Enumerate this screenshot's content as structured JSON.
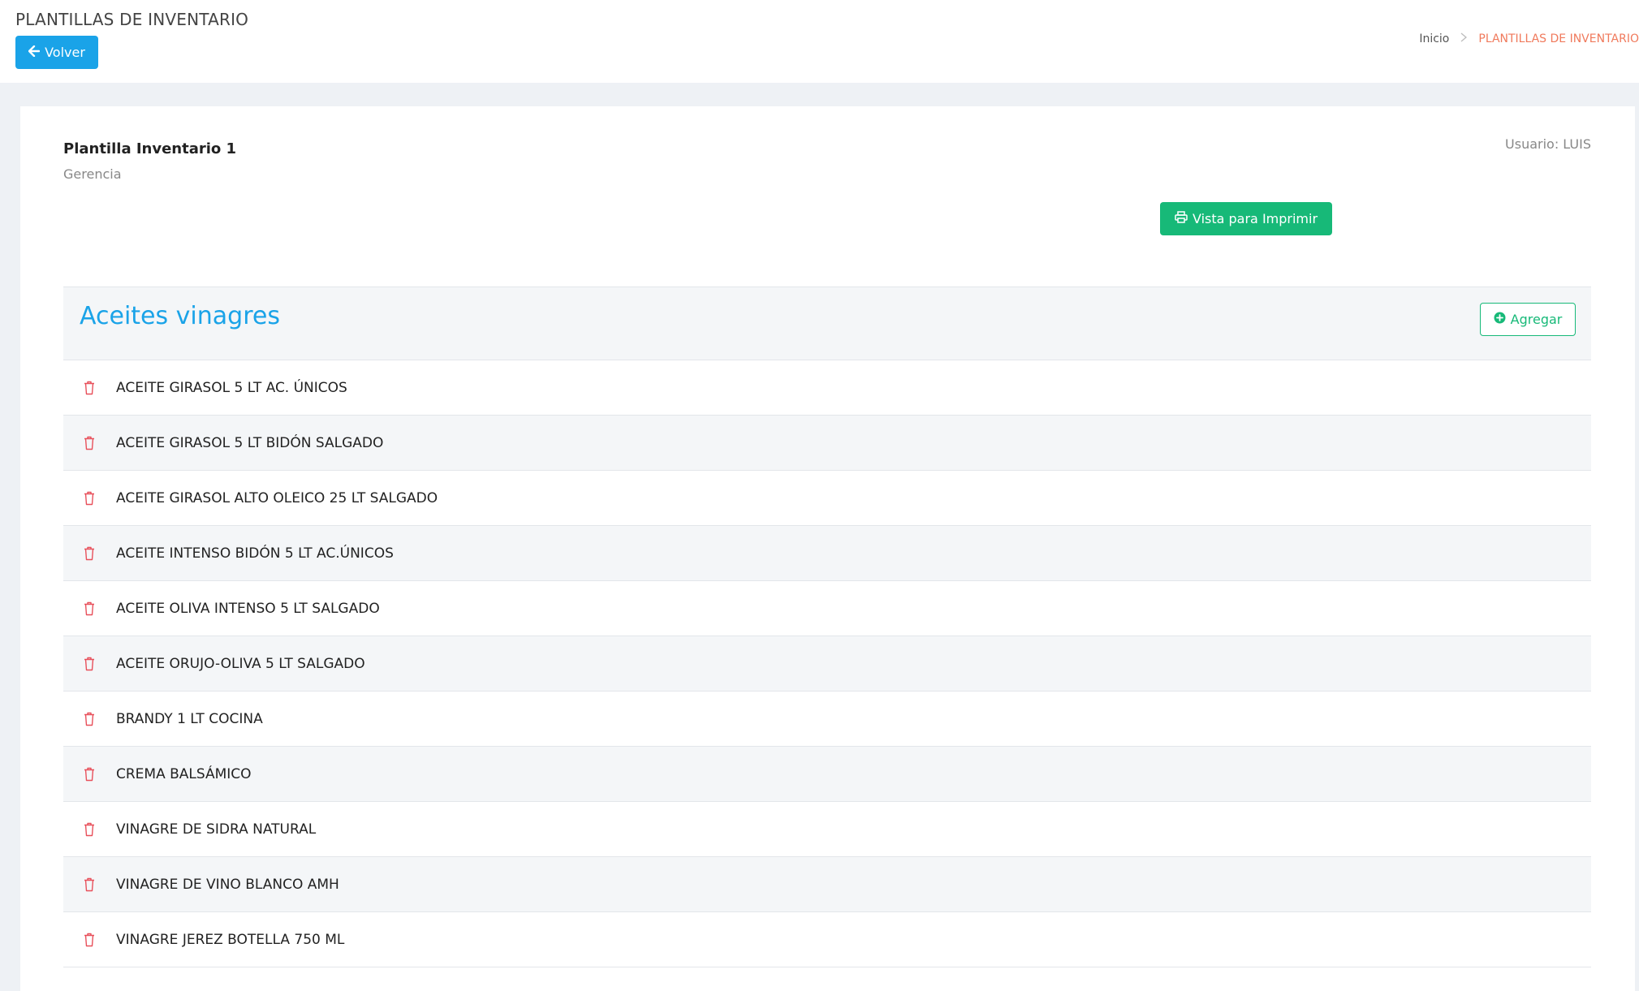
{
  "header": {
    "title": "PLANTILLAS DE INVENTARIO",
    "back_label": "Volver",
    "breadcrumb": {
      "home": "Inicio",
      "current": "PLANTILLAS DE INVENTARIO"
    }
  },
  "template": {
    "name": "Plantilla Inventario 1",
    "department": "Gerencia",
    "user": "Usuario: LUIS",
    "print_label": "Vista para Imprimir"
  },
  "section": {
    "title": "Aceites vinagres",
    "add_label": "Agregar",
    "items": [
      "ACEITE GIRASOL 5 LT AC. ÚNICOS",
      "ACEITE GIRASOL 5 LT BIDÓN SALGADO",
      "ACEITE GIRASOL ALTO OLEICO 25 LT SALGADO",
      "ACEITE INTENSO BIDÓN 5 LT AC.ÚNICOS",
      "ACEITE OLIVA INTENSO 5 LT SALGADO",
      "ACEITE ORUJO-OLIVA 5 LT SALGADO",
      "BRANDY 1 LT COCINA",
      "CREMA BALSÁMICO",
      "VINAGRE DE SIDRA NATURAL",
      "VINAGRE DE VINO BLANCO AMH",
      "VINAGRE JEREZ BOTELLA 750 ML"
    ]
  },
  "colors": {
    "primary": "#1aa3e8",
    "success": "#17b978",
    "danger": "#e8505b",
    "breadcrumb_active": "#f07a5c"
  },
  "icons": {
    "back": "arrow-left-icon",
    "print": "printer-icon",
    "add": "plus-circle-icon",
    "delete": "trash-icon"
  }
}
